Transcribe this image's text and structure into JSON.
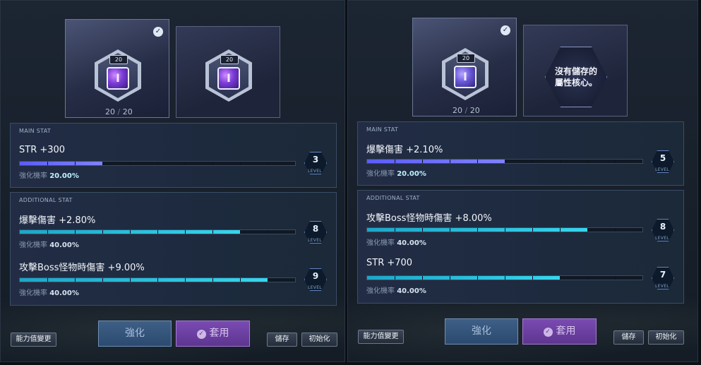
{
  "colors": {
    "purple_bar": "#6b6eff",
    "cyan_bar": "#2fc6e3",
    "enhance_button": "#34557c",
    "apply_button": "#6c40a2"
  },
  "left": {
    "core": {
      "level_badge": "20",
      "glyph": "I",
      "count_current": "20",
      "count_sep": "/",
      "count_max": "20",
      "selected": true
    },
    "stored_core": {
      "level_badge": "20",
      "glyph": "I"
    },
    "main_stat": {
      "title": "MAIN STAT",
      "name": "STR +300",
      "progress": 0.3,
      "rate_label": "強化機率",
      "rate_value": "20.00%",
      "level": "3",
      "level_word": "LEVEL"
    },
    "additional_stat": {
      "title": "ADDITIONAL STAT",
      "items": [
        {
          "name": "爆擊傷害 +2.80%",
          "progress": 0.8,
          "rate_label": "強化機率",
          "rate_value": "40.00%",
          "level": "8",
          "level_word": "LEVEL"
        },
        {
          "name": "攻擊Boss怪物時傷害 +9.00%",
          "progress": 0.9,
          "rate_label": "強化機率",
          "rate_value": "40.00%",
          "level": "9",
          "level_word": "LEVEL"
        }
      ]
    },
    "buttons": {
      "change": "能力值變更",
      "enhance": "強化",
      "apply": "套用",
      "save": "儲存",
      "reset": "初始化"
    }
  },
  "right": {
    "core": {
      "level_badge": "20",
      "glyph": "I",
      "count_current": "20",
      "count_sep": "/",
      "count_max": "20",
      "selected": true
    },
    "empty_slot_text_line1": "沒有儲存的",
    "empty_slot_text_line2": "屬性核心。",
    "main_stat": {
      "title": "MAIN STAT",
      "name": "爆擊傷害 +2.10%",
      "progress": 0.5,
      "rate_label": "強化機率",
      "rate_value": "20.00%",
      "level": "5",
      "level_word": "LEVEL"
    },
    "additional_stat": {
      "title": "ADDITIONAL STAT",
      "items": [
        {
          "name": "攻擊Boss怪物時傷害 +8.00%",
          "progress": 0.8,
          "rate_label": "強化機率",
          "rate_value": "40.00%",
          "level": "8",
          "level_word": "LEVEL"
        },
        {
          "name": "STR +700",
          "progress": 0.7,
          "rate_label": "強化機率",
          "rate_value": "40.00%",
          "level": "7",
          "level_word": "LEVEL"
        }
      ]
    },
    "buttons": {
      "change": "能力值變更",
      "enhance": "強化",
      "apply": "套用",
      "save": "儲存",
      "reset": "初始化"
    }
  }
}
